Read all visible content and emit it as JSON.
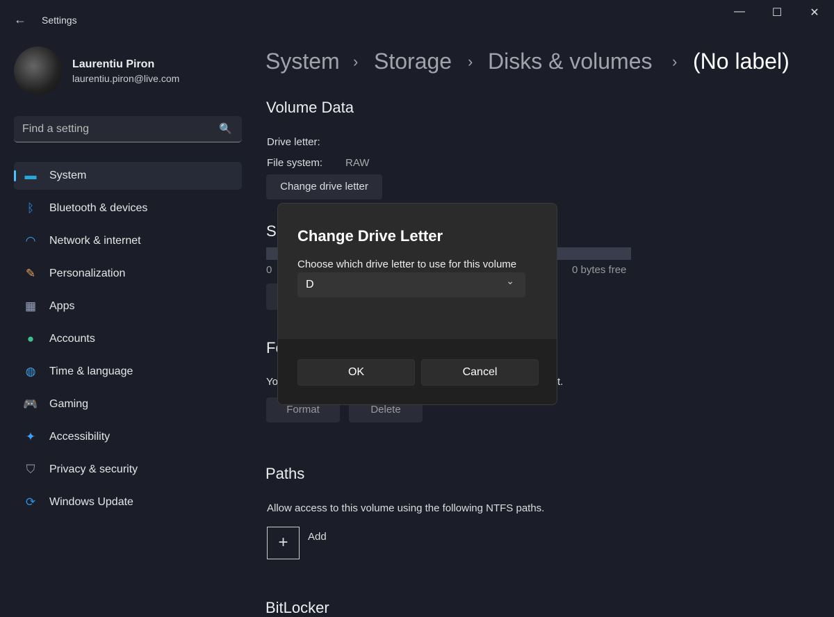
{
  "window": {
    "title": "Settings",
    "back": "←",
    "minimize": "—",
    "maximize": "☐",
    "close": "✕"
  },
  "user": {
    "name": "Laurentiu Piron",
    "email": "laurentiu.piron@live.com"
  },
  "search": {
    "placeholder": "Find a setting",
    "icon": "🔍"
  },
  "sidebar": {
    "items": [
      {
        "label": "System",
        "icon": "▬",
        "color": "#2aa7d8"
      },
      {
        "label": "Bluetooth & devices",
        "icon": "ᛒ",
        "color": "#2a8fe0"
      },
      {
        "label": "Network & internet",
        "icon": "◠",
        "color": "#3aa0e8"
      },
      {
        "label": "Personalization",
        "icon": "✎",
        "color": "#e8a060"
      },
      {
        "label": "Apps",
        "icon": "▦",
        "color": "#9aa6c0"
      },
      {
        "label": "Accounts",
        "icon": "●",
        "color": "#3fbf8f"
      },
      {
        "label": "Time & language",
        "icon": "◍",
        "color": "#3a9ee0"
      },
      {
        "label": "Gaming",
        "icon": "🎮",
        "color": "#bbbbbb"
      },
      {
        "label": "Accessibility",
        "icon": "✦",
        "color": "#3aa0ff"
      },
      {
        "label": "Privacy & security",
        "icon": "⛉",
        "color": "#9aa0aa"
      },
      {
        "label": "Windows Update",
        "icon": "⟳",
        "color": "#2a8fe0"
      }
    ]
  },
  "breadcrumb": [
    "System",
    "Storage",
    "Disks & volumes",
    "(No label)"
  ],
  "breadcrumb_sep": "›",
  "volume": {
    "heading": "Volume Data",
    "drive_letter_label": "Drive letter:",
    "fs_label": "File system:",
    "fs_value": "RAW",
    "change_btn": "Change drive letter"
  },
  "size_fragment": {
    "heading": "Si",
    "used": "0",
    "free": "0 bytes free"
  },
  "format_fragment": {
    "heading": "Fo",
    "text_start": "Yo",
    "text_end": "t.",
    "format_btn": "Format",
    "delete_btn": "Delete"
  },
  "paths": {
    "heading": "Paths",
    "desc": "Allow access to this volume using the following NTFS paths.",
    "add_icon": "+",
    "add_label": "Add"
  },
  "bitlocker": {
    "heading": "BitLocker"
  },
  "dialog": {
    "title": "Change Drive Letter",
    "prompt": "Choose which drive letter to use for this volume",
    "selected": "D",
    "chevron": "⌄",
    "ok": "OK",
    "cancel": "Cancel"
  }
}
